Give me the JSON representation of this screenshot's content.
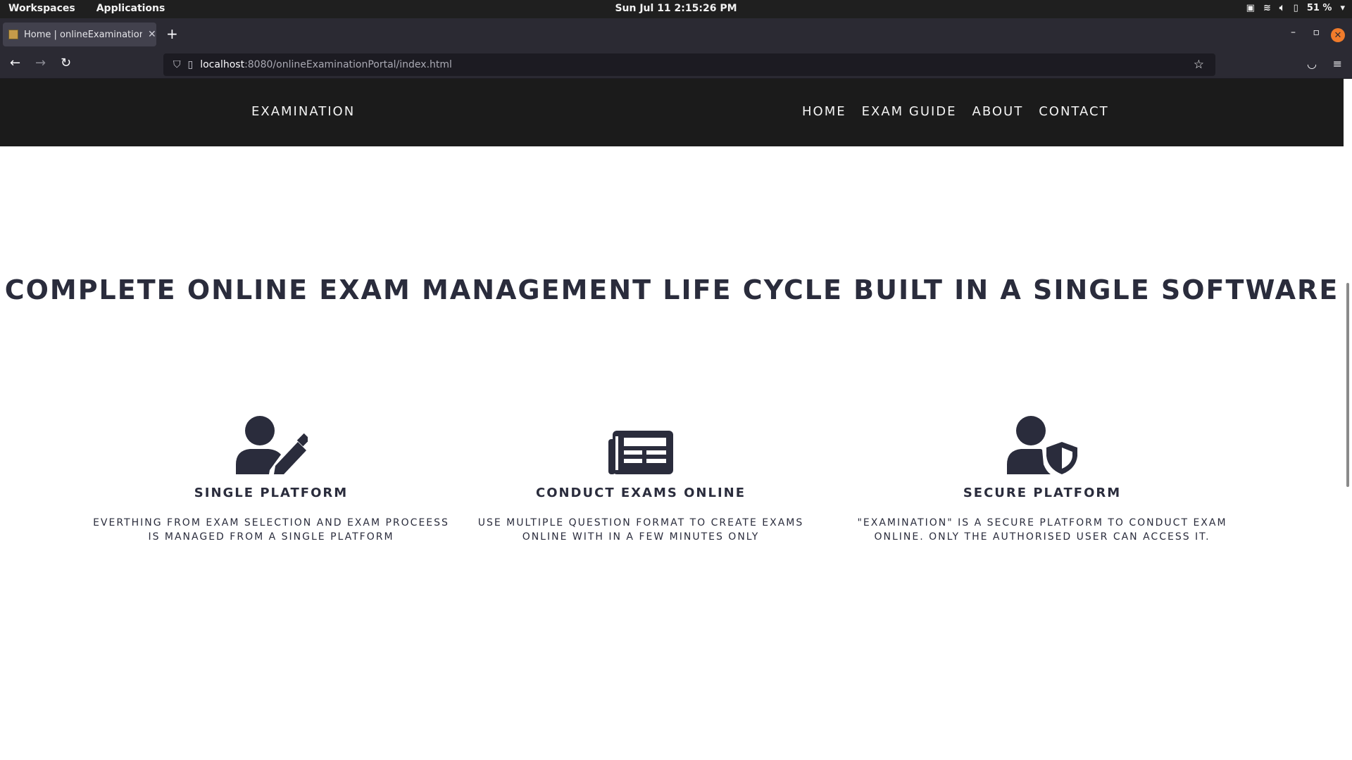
{
  "os": {
    "workspaces": "Workspaces",
    "applications": "Applications",
    "clock": "Sun Jul 11   2:15:26 PM",
    "battery": "51 %"
  },
  "browser": {
    "tab_title": "Home | onlineExaminationPortal",
    "url_host": "localhost",
    "url_path": ":8080/onlineExaminationPortal/index.html"
  },
  "site": {
    "brand": "EXAMINATION",
    "menu": [
      "HOME",
      "EXAM GUIDE",
      "ABOUT",
      "CONTACT"
    ],
    "headline": "COMPLETE ONLINE EXAM MANAGEMENT LIFE CYCLE BUILT IN A SINGLE SOFTWARE",
    "features": [
      {
        "icon": "user-edit-icon",
        "title": "SINGLE PLATFORM",
        "desc_line1": "EVERTHING FROM EXAM SELECTION AND EXAM PROCEESS",
        "desc_line2": "IS MANAGED FROM A SINGLE PLATFORM"
      },
      {
        "icon": "newspaper-icon",
        "title": "CONDUCT EXAMS ONLINE",
        "desc_line1": "USE MULTIPLE QUESTION FORMAT TO CREATE EXAMS",
        "desc_line2": "ONLINE WITH IN A FEW MINUTES ONLY"
      },
      {
        "icon": "user-shield-icon",
        "title": "SECURE PLATFORM",
        "desc_line1": "\"EXAMINATION\" IS A SECURE PLATFORM TO CONDUCT EXAM",
        "desc_line2": "ONLINE. ONLY THE AUTHORISED USER CAN ACCESS IT."
      }
    ]
  },
  "colors": {
    "header_bg": "#1b1b1b",
    "text_dark": "#2a2c3c",
    "browser_chrome": "#2b2a33"
  }
}
